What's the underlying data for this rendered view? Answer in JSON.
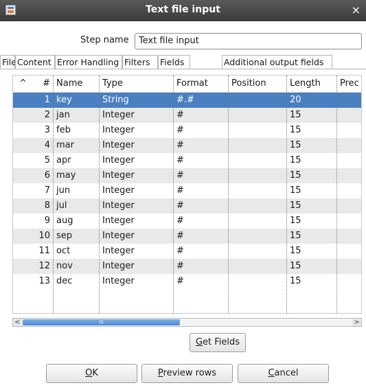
{
  "window": {
    "title": "Text file input",
    "close_glyph": "×"
  },
  "step_name": {
    "label": "Step name",
    "value": "Text file input"
  },
  "tabs": [
    {
      "label": "File"
    },
    {
      "label": "Content"
    },
    {
      "label": "Error Handling"
    },
    {
      "label": "Filters"
    },
    {
      "label": "Fields",
      "active": true
    },
    {
      "label": "Additional output fields"
    }
  ],
  "table": {
    "sort_glyph": "^",
    "columns": [
      "#",
      "Name",
      "Type",
      "Format",
      "Position",
      "Length",
      "Prec"
    ],
    "selected_row": 1,
    "rows": [
      {
        "num": "1",
        "name": "key",
        "type": "String",
        "format": "#.#",
        "position": "",
        "length": "20"
      },
      {
        "num": "2",
        "name": "jan",
        "type": "Integer",
        "format": "#",
        "position": "",
        "length": "15"
      },
      {
        "num": "3",
        "name": "feb",
        "type": "Integer",
        "format": "#",
        "position": "",
        "length": "15"
      },
      {
        "num": "4",
        "name": "mar",
        "type": "Integer",
        "format": "#",
        "position": "",
        "length": "15"
      },
      {
        "num": "5",
        "name": "apr",
        "type": "Integer",
        "format": "#",
        "position": "",
        "length": "15"
      },
      {
        "num": "6",
        "name": "may",
        "type": "Integer",
        "format": "#",
        "position": "",
        "length": "15"
      },
      {
        "num": "7",
        "name": "jun",
        "type": "Integer",
        "format": "#",
        "position": "",
        "length": "15"
      },
      {
        "num": "8",
        "name": "jul",
        "type": "Integer",
        "format": "#",
        "position": "",
        "length": "15"
      },
      {
        "num": "9",
        "name": "aug",
        "type": "Integer",
        "format": "#",
        "position": "",
        "length": "15"
      },
      {
        "num": "10",
        "name": "sep",
        "type": "Integer",
        "format": "#",
        "position": "",
        "length": "15"
      },
      {
        "num": "11",
        "name": "oct",
        "type": "Integer",
        "format": "#",
        "position": "",
        "length": "15"
      },
      {
        "num": "12",
        "name": "nov",
        "type": "Integer",
        "format": "#",
        "position": "",
        "length": "15"
      },
      {
        "num": "13",
        "name": "dec",
        "type": "Integer",
        "format": "#",
        "position": "",
        "length": "15"
      }
    ]
  },
  "scrollbar": {
    "left_glyph": "<",
    "right_glyph": ">",
    "grip_glyph": "III"
  },
  "buttons": {
    "get_fields": {
      "mnemonic": "G",
      "rest": "et Fields"
    },
    "ok": {
      "mnemonic": "O",
      "rest": "K"
    },
    "preview": {
      "mnemonic": "P",
      "rest": "review rows"
    },
    "cancel": {
      "mnemonic": "C",
      "rest": "ancel"
    }
  },
  "colors": {
    "selection": "#4a7fc1",
    "alt_row": "#e9e9e9",
    "titlebar": "#3b3b3b"
  }
}
